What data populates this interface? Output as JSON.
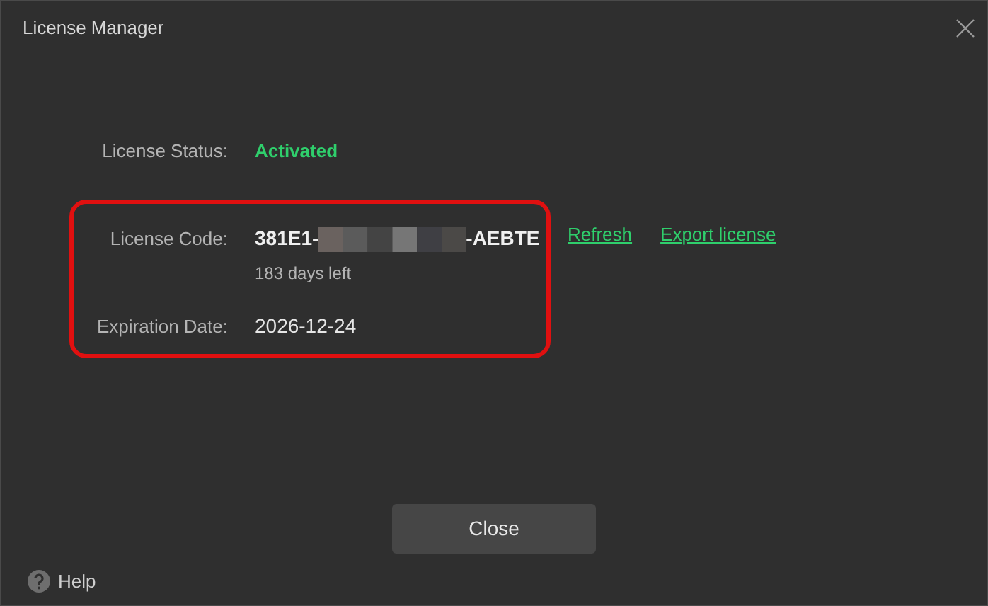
{
  "window": {
    "title": "License Manager"
  },
  "status": {
    "label": "License Status:",
    "value": "Activated"
  },
  "license_code": {
    "label": "License Code:",
    "code_prefix": "381E1-",
    "code_suffix": "-AEBTE",
    "remaining": "183 days left"
  },
  "expiration": {
    "label": "Expiration Date:",
    "value": "2026-12-24"
  },
  "links": [
    "Refresh",
    "Export license"
  ],
  "buttons": {
    "close": "Close",
    "help": "Help"
  }
}
